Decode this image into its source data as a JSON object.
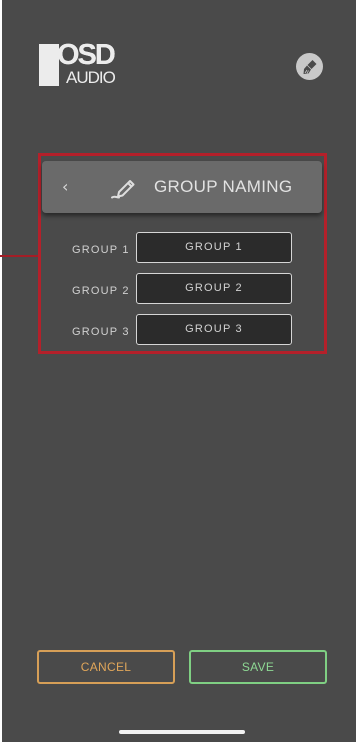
{
  "logo": {
    "top_text": "OSD",
    "bottom_text": "AUDIO"
  },
  "toolbar": {
    "clean_icon": "broom-icon"
  },
  "header": {
    "back_icon": "chevron-left-icon",
    "back_glyph": "‹",
    "edit_icon": "pen-edit-icon",
    "title": "GROUP NAMING"
  },
  "groups": [
    {
      "label": "GROUP 1",
      "value": "GROUP 1"
    },
    {
      "label": "GROUP 2",
      "value": "GROUP 2"
    },
    {
      "label": "GROUP 3",
      "value": "GROUP 3"
    }
  ],
  "actions": {
    "cancel_label": "CANCEL",
    "save_label": "SAVE"
  },
  "colors": {
    "background": "#4a4a4a",
    "highlight": "#b4202a",
    "cancel": "#d69f57",
    "save": "#7fcf83"
  }
}
